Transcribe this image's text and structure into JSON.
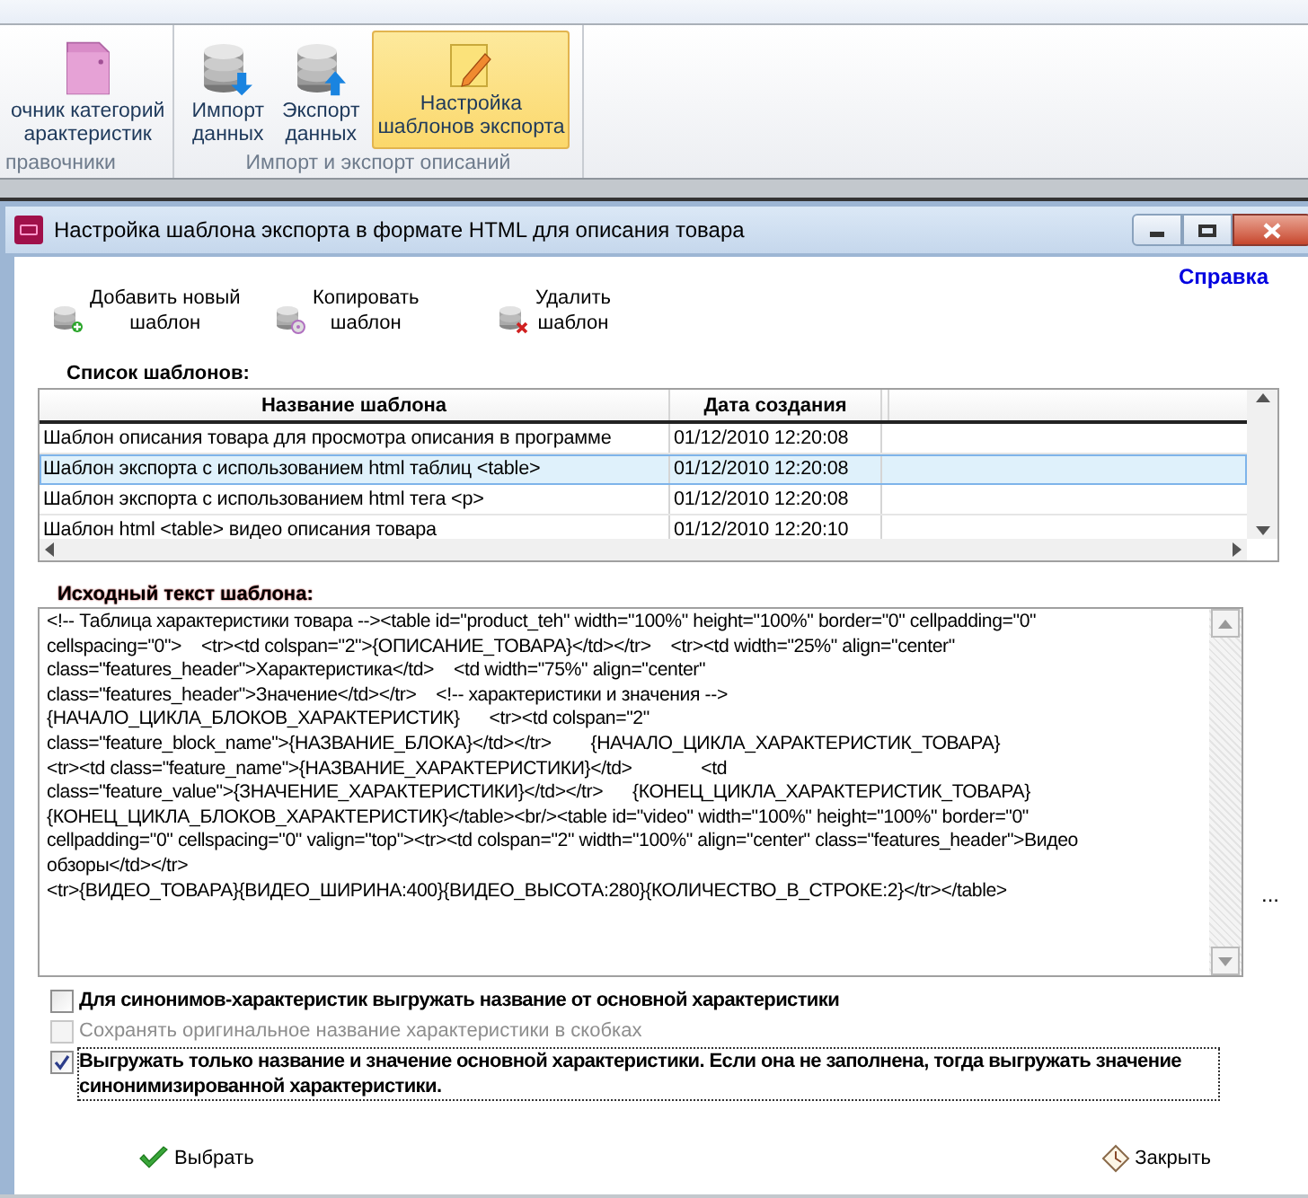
{
  "ribbon": {
    "groups": [
      {
        "label": "правочники",
        "buttons": [
          {
            "label": "очник категорий\nарактеристик",
            "kind": "folder",
            "selected": false
          }
        ]
      },
      {
        "label": "Импорт и экспорт описаний",
        "buttons": [
          {
            "label": "Импорт\nданных",
            "kind": "db-import",
            "selected": false
          },
          {
            "label": "Экспорт\nданных",
            "kind": "db-export",
            "selected": false
          },
          {
            "label": "Настройка\nшаблонов экспорта",
            "kind": "note",
            "selected": true
          }
        ]
      }
    ]
  },
  "window": {
    "title": "Настройка шаблона экспорта в формате HTML для описания товара"
  },
  "help_link": "Справка",
  "toolbar": [
    {
      "label": "Добавить новый\nшаблон",
      "kind": "add"
    },
    {
      "label": "Копировать\nшаблон",
      "kind": "copy"
    },
    {
      "label": "Удалить\nшаблон",
      "kind": "delete"
    }
  ],
  "templates_label": "Список шаблонов:",
  "table": {
    "columns": [
      "Название шаблона",
      "Дата создания"
    ],
    "rows": [
      {
        "cells": [
          "Шаблон описания товара для просмотра описания в программе",
          "01/12/2010 12:20:08"
        ],
        "selected": false
      },
      {
        "cells": [
          "Шаблон экспорта с использованием html таблиц <table>",
          "01/12/2010 12:20:08"
        ],
        "selected": true
      },
      {
        "cells": [
          "Шаблон экспорта с использованием html тега <p>",
          "01/12/2010 12:20:08"
        ],
        "selected": false
      },
      {
        "cells": [
          "Шаблон html <table> видео описания товара",
          "01/12/2010 12:20:10"
        ],
        "selected": false
      }
    ]
  },
  "source_label": "Исходный текст шаблона:",
  "source_lines": [
    "<!-- Таблица характеристики товара --><table id=\"product_teh\" width=\"100%\" height=\"100%\" border=\"0\" cellpadding=\"0\"",
    "cellspacing=\"0\">    <tr><td colspan=\"2\">{ОПИСАНИЕ_ТОВАРА}</td></tr>    <tr><td width=\"25%\" align=\"center\"",
    "class=\"features_header\">Характеристика</td>    <td width=\"75%\" align=\"center\"",
    "class=\"features_header\">Значение</td></tr>    <!-- характеристики и значения -->",
    "{НАЧАЛО_ЦИКЛА_БЛОКОВ_ХАРАКТЕРИСТИК}      <tr><td colspan=\"2\"",
    "class=\"feature_block_name\">{НАЗВАНИЕ_БЛОКА}</td></tr>        {НАЧАЛО_ЦИКЛА_ХАРАКТЕРИСТИК_ТОВАРА}",
    "<tr><td class=\"feature_name\">{НАЗВАНИЕ_ХАРАКТЕРИСТИКИ}</td>              <td",
    "class=\"feature_value\">{ЗНАЧЕНИЕ_ХАРАКТЕРИСТИКИ}</td></tr>      {КОНЕЦ_ЦИКЛА_ХАРАКТЕРИСТИК_ТОВАРА}",
    "{КОНЕЦ_ЦИКЛА_БЛОКОВ_ХАРАКТЕРИСТИК}</table><br/><table id=\"video\" width=\"100%\" height=\"100%\" border=\"0\"",
    "cellpadding=\"0\" cellspacing=\"0\" valign=\"top\"><tr><td colspan=\"2\" width=\"100%\" align=\"center\" class=\"features_header\">Видео",
    "обзоры</td></tr>",
    "<tr>{ВИДЕО_ТОВАРА}{ВИДЕО_ШИРИНА:400}{ВИДЕО_ВЫСОТА:280}{КОЛИЧЕСТВО_В_СТРОКЕ:2}</tr></table>"
  ],
  "more_button": "...",
  "options": [
    {
      "label": "Для синонимов-характеристик выгружать название от основной характеристики",
      "checked": false,
      "disabled": false
    },
    {
      "label": "Сохранять оригинальное название характеристики в скобках",
      "checked": false,
      "disabled": true
    },
    {
      "label": "Выгружать только название и значение основной характеристики. Если она не заполнена, тогда выгружать значение синонимизированной характеристики.",
      "checked": true,
      "disabled": false
    }
  ],
  "buttons": [
    {
      "label": "Выбрать",
      "kind": "ok"
    },
    {
      "label": "Закрыть",
      "kind": "close"
    }
  ]
}
